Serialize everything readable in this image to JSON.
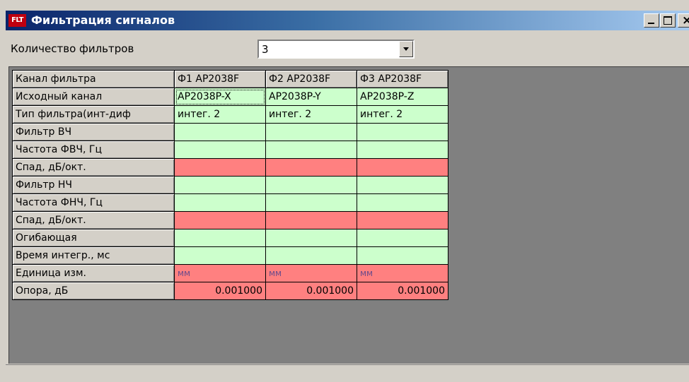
{
  "window": {
    "icon_text": "FLT",
    "title": "Фильтрация сигналов"
  },
  "filter_count": {
    "label": "Количество фильтров",
    "value": "3"
  },
  "grid": {
    "corner": "Канал фильтра",
    "columns": [
      "Ф1 AP2038F",
      "Ф2 AP2038F",
      "Ф3 AP2038F"
    ],
    "rows": [
      {
        "label": "Исходный канал",
        "color": "green",
        "cells": [
          "AP2038P-X",
          "AP2038P-Y",
          "AP2038P-Z"
        ]
      },
      {
        "label": "Тип фильтра(инт-диф",
        "color": "green",
        "cells": [
          "интег. 2",
          "интег. 2",
          "интег. 2"
        ]
      },
      {
        "label": "Фильтр ВЧ",
        "color": "green",
        "cells": [
          "",
          "",
          ""
        ]
      },
      {
        "label": "Частота ФВЧ, Гц",
        "color": "green",
        "cells": [
          "",
          "",
          ""
        ]
      },
      {
        "label": "Спад, дБ/окт.",
        "color": "red",
        "cells": [
          "",
          "",
          ""
        ]
      },
      {
        "label": "Фильтр НЧ",
        "color": "green",
        "cells": [
          "",
          "",
          ""
        ]
      },
      {
        "label": "Частота ФНЧ, Гц",
        "color": "green",
        "cells": [
          "",
          "",
          ""
        ]
      },
      {
        "label": "Спад, дБ/окт.",
        "color": "red",
        "cells": [
          "",
          "",
          ""
        ]
      },
      {
        "label": "Огибающая",
        "color": "green",
        "cells": [
          "",
          "",
          ""
        ]
      },
      {
        "label": "Время интегр., мс",
        "color": "green",
        "cells": [
          "",
          "",
          ""
        ]
      },
      {
        "label": "Единица изм.",
        "color": "red",
        "cells": [
          "мм",
          "мм",
          "мм"
        ]
      },
      {
        "label": "Опора, дБ",
        "color": "red",
        "cells": [
          "0.001000",
          "0.001000",
          "0.001000"
        ]
      }
    ]
  },
  "colors": {
    "green_cell": "#ccffcc",
    "red_cell": "#ff8080",
    "titlebar_start": "#0a246a",
    "titlebar_end": "#a6caf0"
  },
  "icons": {
    "minimize": "minimize-icon",
    "maximize": "maximize-icon",
    "close": "close-icon",
    "dropdown": "chevron-down-icon"
  }
}
